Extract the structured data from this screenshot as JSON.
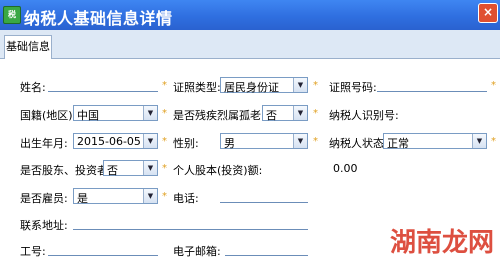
{
  "window": {
    "title": "纳税人基础信息详情",
    "close_symbol": "×",
    "app_icon_text": "税"
  },
  "tabs": [
    {
      "label": "基础信息"
    }
  ],
  "form": {
    "name": {
      "label": "姓名:",
      "value": ""
    },
    "id_type": {
      "label": "证照类型:",
      "value": "居民身份证"
    },
    "id_number": {
      "label": "证照号码:",
      "value": ""
    },
    "nationality": {
      "label": "国籍(地区):",
      "value": "中国"
    },
    "disabled": {
      "label": "是否残疾烈属孤老:",
      "value": "否"
    },
    "taxpayer_id": {
      "label": "纳税人识别号:"
    },
    "birth_date": {
      "label": "出生年月:",
      "value": "2015-06-05"
    },
    "gender": {
      "label": "性别:",
      "value": "男"
    },
    "taxpayer_status": {
      "label": "纳税人状态:",
      "value": "正常"
    },
    "shareholder": {
      "label": "是否股东、投资者:",
      "value": "否"
    },
    "personal_equity": {
      "label": "个人股本(投资)额:",
      "value": "0.00"
    },
    "employee": {
      "label": "是否雇员:",
      "value": "是"
    },
    "phone": {
      "label": "电话:",
      "value": ""
    },
    "address": {
      "label": "联系地址:",
      "value": ""
    },
    "staff_no": {
      "label": "工号:",
      "value": ""
    },
    "email": {
      "label": "电子邮箱:",
      "value": ""
    }
  },
  "required_marker": "*",
  "dropdown_arrow": "▼",
  "watermark": "湖南龙网",
  "colors": {
    "title_bar": "#2f6fe0",
    "required": "#e0a020",
    "watermark": "#d8311f",
    "field_border": "#7a9cc4"
  }
}
